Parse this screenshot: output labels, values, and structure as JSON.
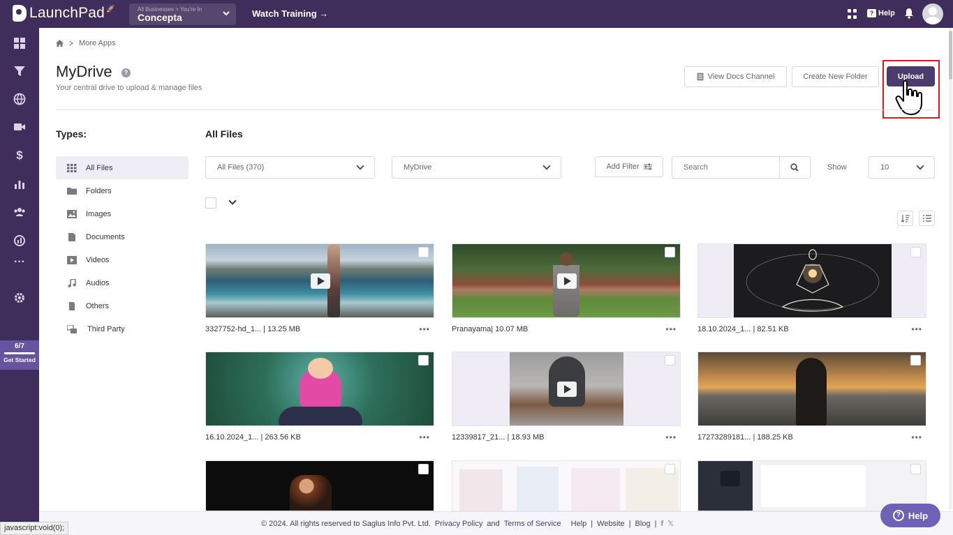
{
  "app": {
    "name": "LaunchPad",
    "business_label": "All Businesses > You're In",
    "business_name": "Concepta",
    "watch_training": "Watch Training →",
    "help_label": "Help"
  },
  "sidebar": {
    "icons": [
      "dashboard-icon",
      "funnel-icon",
      "globe-icon",
      "video-icon",
      "dollar-icon",
      "chart-icon",
      "users-icon",
      "analytics-icon",
      "more-icon",
      "gear-icon"
    ],
    "get_started_count": "6/7",
    "get_started_label": "Get Started"
  },
  "breadcrumb": {
    "current": "More Apps"
  },
  "page": {
    "title": "MyDrive",
    "subtitle": "Your central drive to upload & manage files",
    "view_docs": "View Docs Channel",
    "create_folder": "Create New Folder",
    "upload": "Upload"
  },
  "types": {
    "heading": "Types:",
    "items": [
      {
        "label": "All Files",
        "icon": "grid-icon"
      },
      {
        "label": "Folders",
        "icon": "folder-icon"
      },
      {
        "label": "Images",
        "icon": "image-icon"
      },
      {
        "label": "Documents",
        "icon": "document-icon"
      },
      {
        "label": "Videos",
        "icon": "video-icon"
      },
      {
        "label": "Audios",
        "icon": "music-icon"
      },
      {
        "label": "Others",
        "icon": "file-icon"
      },
      {
        "label": "Third Party",
        "icon": "third-party-icon"
      }
    ]
  },
  "files": {
    "heading": "All Files",
    "filter_select": "All Files (370)",
    "source_select": "MyDrive",
    "add_filter": "Add Filter",
    "search_placeholder": "Search",
    "show_label": "Show",
    "show_value": "10",
    "cards": [
      {
        "name": "3327752-hd_1... | 13.25 MB",
        "video": true
      },
      {
        "name": "Pranayama| 10.07 MB",
        "video": true
      },
      {
        "name": "18.10.2024_1... | 82.51 KB",
        "video": false
      },
      {
        "name": "16.10.2024_1... | 263.56 KB",
        "video": false
      },
      {
        "name": "12339817_21... | 18.93 MB",
        "video": true
      },
      {
        "name": "17273289181... | 188.25 KB",
        "video": false
      },
      {
        "name": "",
        "video": false
      },
      {
        "name": "",
        "video": false
      },
      {
        "name": "",
        "video": false
      }
    ]
  },
  "footer": {
    "copyright": "© 2024. All rights reserved to Saglus Info Pvt. Ltd.",
    "privacy": "Privacy Policy",
    "and": "and",
    "terms": "Terms of Service",
    "help": "Help",
    "website": "Website",
    "blog": "Blog",
    "sep": "|"
  },
  "status_bar": "javascript:void(0);",
  "help_fab": "Help"
}
